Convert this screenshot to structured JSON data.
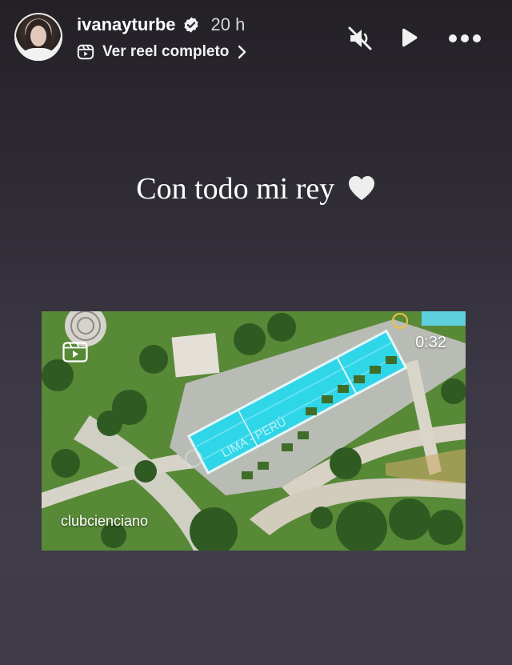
{
  "story": {
    "username": "ivanayturbe",
    "time_ago": "20 h",
    "reel_link_label": "Ver reel completo",
    "caption": "Con todo mi rey"
  },
  "reel": {
    "duration": "0:32",
    "author": "clubcienciano",
    "pool_text": "LIMA - PERÚ"
  },
  "icons": {
    "verified": "verified-badge-icon",
    "reels": "reels-icon",
    "chevron": "chevron-right-icon",
    "mute": "speaker-muted-icon",
    "play": "play-icon",
    "more": "more-options-icon",
    "heart": "white-heart-icon"
  },
  "colors": {
    "background_top": "#232026",
    "background_bottom": "#403c48",
    "pool": "#2fd6e8",
    "grass": "#5a8a3a"
  }
}
